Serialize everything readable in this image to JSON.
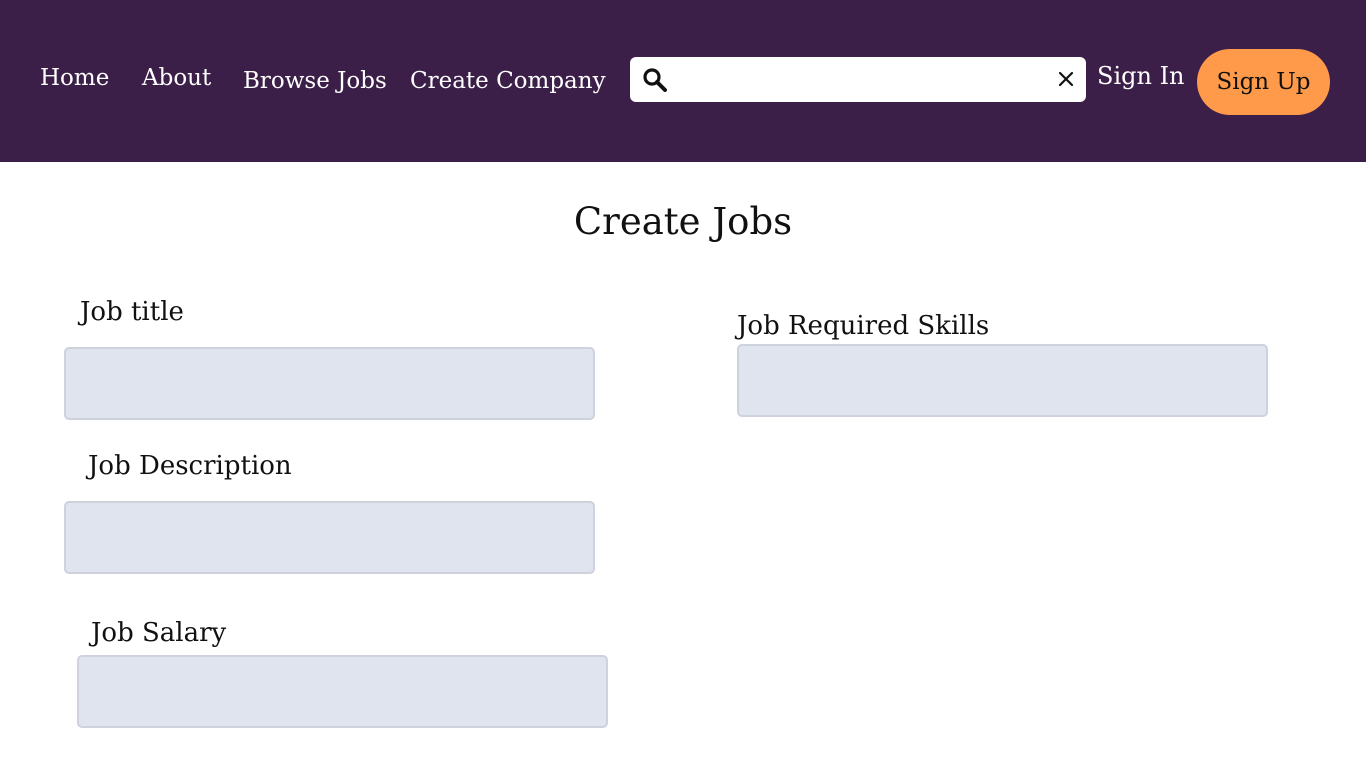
{
  "nav": {
    "home": "Home",
    "about": "About",
    "browse_jobs": "Browse Jobs",
    "create_company": "Create Company",
    "sign_in": "Sign In",
    "sign_up": "Sign Up"
  },
  "search": {
    "value": "",
    "icon": "search-icon",
    "clear_icon": "close-icon"
  },
  "page": {
    "title": "Create Jobs"
  },
  "form": {
    "job_title_label": "Job title",
    "job_title_value": "",
    "job_description_label": "Job Description",
    "job_description_value": "",
    "job_salary_label": "Job Salary",
    "job_salary_value": "",
    "job_skills_label": "Job Required Skills",
    "job_skills_value": ""
  },
  "colors": {
    "navbar_bg": "#3c1f48",
    "signup_bg": "#fe9a4a",
    "input_bg": "#e0e4ee"
  }
}
